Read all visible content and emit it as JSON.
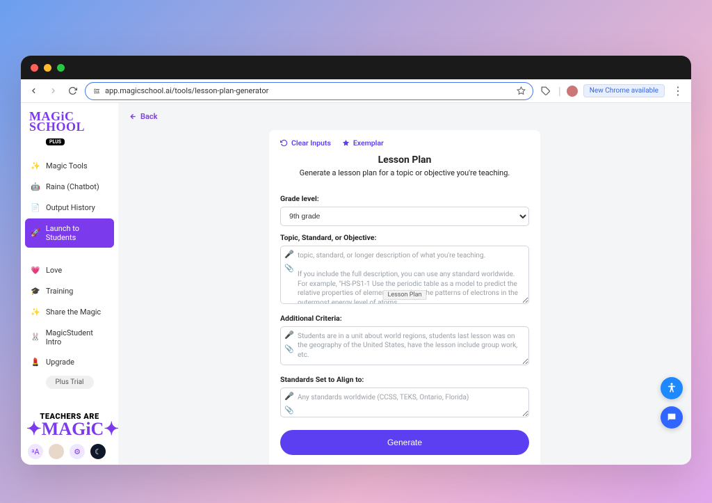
{
  "browser": {
    "url": "app.magicschool.ai/tools/lesson-plan-generator",
    "new_chrome": "New Chrome available"
  },
  "logo": {
    "line1": "MAGiC",
    "line2": "SCHOOL",
    "plus": "PLUS"
  },
  "sidebar": {
    "items": [
      {
        "label": "Magic Tools",
        "icon": "✨"
      },
      {
        "label": "Raina (Chatbot)",
        "icon": "🤖"
      },
      {
        "label": "Output History",
        "icon": "📄"
      },
      {
        "label": "Launch to Students",
        "icon": "🚀"
      }
    ],
    "secondary": [
      {
        "label": "Love",
        "icon": "💗"
      },
      {
        "label": "Training",
        "icon": "🎓"
      },
      {
        "label": "Share the Magic",
        "icon": "✨"
      },
      {
        "label": "MagicStudent Intro",
        "icon": "🐰"
      },
      {
        "label": "Upgrade",
        "icon": "💄"
      }
    ],
    "trial": "Plus Trial",
    "badge": {
      "line1": "TEACHERS ARE",
      "line2": "MAGiC"
    }
  },
  "back": "Back",
  "chips": {
    "clear": "Clear Inputs",
    "exemplar": "Exemplar"
  },
  "form": {
    "title": "Lesson Plan",
    "subtitle": "Generate a lesson plan for a topic or objective you're teaching.",
    "grade_label": "Grade level:",
    "grade_value": "9th grade",
    "topic_label": "Topic, Standard, or Objective:",
    "topic_placeholder": "topic, standard, or longer description of what you're teaching.\n\nIf you include the full description, you can use any standard worldwide.  For example, \"HS-PS1-1 Use the periodic table as a model to predict the relative properties of elements based on the patterns of electrons in the outermost energy level of atoms.",
    "topic_tooltip": "Lesson Plan",
    "additional_label": "Additional Criteria:",
    "additional_placeholder": "Students are in a unit about world regions, students last lesson was on the geography of the United States, have the lesson include group work, etc.",
    "standards_label": "Standards Set to Align to:",
    "standards_placeholder": "Any standards worldwide (CCSS, TEKS, Ontario, Florida)",
    "generate": "Generate"
  }
}
